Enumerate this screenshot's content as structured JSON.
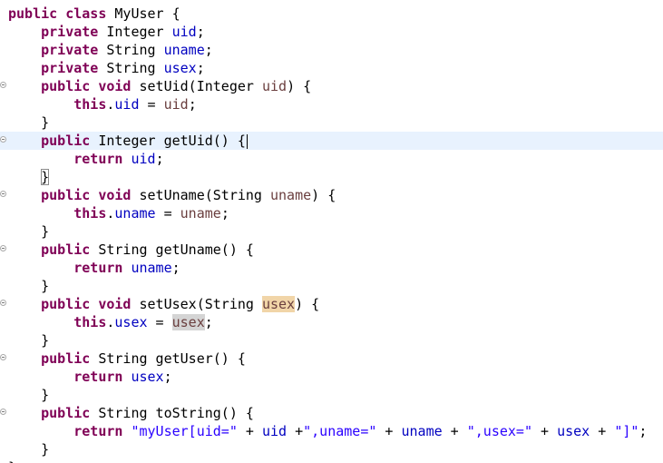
{
  "editor": {
    "language": "java",
    "colors": {
      "keyword": "#7f0055",
      "field": "#0000c0",
      "parameter": "#6a3e3e",
      "string": "#2a00ff",
      "current_line": "#e8f2fe",
      "occurrence_write": "#f1d5a8",
      "occurrence_read": "#d4d4d4"
    },
    "lines": [
      {
        "tokens": [
          {
            "t": "public class",
            "c": "kw"
          },
          {
            "t": " MyUser {",
            "c": ""
          }
        ]
      },
      {
        "tokens": [
          {
            "t": "    ",
            "c": ""
          },
          {
            "t": "private",
            "c": "kw"
          },
          {
            "t": " Integer ",
            "c": ""
          },
          {
            "t": "uid",
            "c": "fld"
          },
          {
            "t": ";",
            "c": ""
          }
        ]
      },
      {
        "tokens": [
          {
            "t": "    ",
            "c": ""
          },
          {
            "t": "private",
            "c": "kw"
          },
          {
            "t": " String ",
            "c": ""
          },
          {
            "t": "uname",
            "c": "fld"
          },
          {
            "t": ";",
            "c": ""
          }
        ]
      },
      {
        "tokens": [
          {
            "t": "    ",
            "c": ""
          },
          {
            "t": "private",
            "c": "kw"
          },
          {
            "t": " String ",
            "c": ""
          },
          {
            "t": "usex",
            "c": "fld"
          },
          {
            "t": ";",
            "c": ""
          }
        ]
      },
      {
        "fold": true,
        "tokens": [
          {
            "t": "    ",
            "c": ""
          },
          {
            "t": "public void",
            "c": "kw"
          },
          {
            "t": " setUid(Integer ",
            "c": ""
          },
          {
            "t": "uid",
            "c": "prm"
          },
          {
            "t": ") {",
            "c": ""
          }
        ]
      },
      {
        "tokens": [
          {
            "t": "        ",
            "c": ""
          },
          {
            "t": "this",
            "c": "kw"
          },
          {
            "t": ".",
            "c": ""
          },
          {
            "t": "uid",
            "c": "fld"
          },
          {
            "t": " = ",
            "c": ""
          },
          {
            "t": "uid",
            "c": "prm"
          },
          {
            "t": ";",
            "c": ""
          }
        ]
      },
      {
        "tokens": [
          {
            "t": "    }",
            "c": ""
          }
        ]
      },
      {
        "fold": true,
        "current": true,
        "caret": true,
        "tokens": [
          {
            "t": "    ",
            "c": ""
          },
          {
            "t": "public",
            "c": "kw"
          },
          {
            "t": " Integer getUid() {",
            "c": ""
          }
        ]
      },
      {
        "tokens": [
          {
            "t": "        ",
            "c": ""
          },
          {
            "t": "return",
            "c": "kw"
          },
          {
            "t": " ",
            "c": ""
          },
          {
            "t": "uid",
            "c": "fld"
          },
          {
            "t": ";",
            "c": ""
          }
        ]
      },
      {
        "tokens": [
          {
            "t": "    ",
            "c": ""
          },
          {
            "t": "}",
            "c": "bracket-box"
          }
        ]
      },
      {
        "fold": true,
        "tokens": [
          {
            "t": "    ",
            "c": ""
          },
          {
            "t": "public void",
            "c": "kw"
          },
          {
            "t": " setUname(String ",
            "c": ""
          },
          {
            "t": "uname",
            "c": "prm"
          },
          {
            "t": ") {",
            "c": ""
          }
        ]
      },
      {
        "tokens": [
          {
            "t": "        ",
            "c": ""
          },
          {
            "t": "this",
            "c": "kw"
          },
          {
            "t": ".",
            "c": ""
          },
          {
            "t": "uname",
            "c": "fld"
          },
          {
            "t": " = ",
            "c": ""
          },
          {
            "t": "uname",
            "c": "prm"
          },
          {
            "t": ";",
            "c": ""
          }
        ]
      },
      {
        "tokens": [
          {
            "t": "    }",
            "c": ""
          }
        ]
      },
      {
        "fold": true,
        "tokens": [
          {
            "t": "    ",
            "c": ""
          },
          {
            "t": "public",
            "c": "kw"
          },
          {
            "t": " String getUname() {",
            "c": ""
          }
        ]
      },
      {
        "tokens": [
          {
            "t": "        ",
            "c": ""
          },
          {
            "t": "return",
            "c": "kw"
          },
          {
            "t": " ",
            "c": ""
          },
          {
            "t": "uname",
            "c": "fld"
          },
          {
            "t": ";",
            "c": ""
          }
        ]
      },
      {
        "tokens": [
          {
            "t": "    }",
            "c": ""
          }
        ]
      },
      {
        "fold": true,
        "tokens": [
          {
            "t": "    ",
            "c": ""
          },
          {
            "t": "public void",
            "c": "kw"
          },
          {
            "t": " setUsex(String ",
            "c": ""
          },
          {
            "t": "usex",
            "c": "prm occ-write"
          },
          {
            "t": ") {",
            "c": ""
          }
        ]
      },
      {
        "tokens": [
          {
            "t": "        ",
            "c": ""
          },
          {
            "t": "this",
            "c": "kw"
          },
          {
            "t": ".",
            "c": ""
          },
          {
            "t": "usex",
            "c": "fld"
          },
          {
            "t": " = ",
            "c": ""
          },
          {
            "t": "usex",
            "c": "prm occ-read"
          },
          {
            "t": ";",
            "c": ""
          }
        ]
      },
      {
        "tokens": [
          {
            "t": "    }",
            "c": ""
          }
        ]
      },
      {
        "fold": true,
        "tokens": [
          {
            "t": "    ",
            "c": ""
          },
          {
            "t": "public",
            "c": "kw"
          },
          {
            "t": " String getUser() {",
            "c": ""
          }
        ]
      },
      {
        "tokens": [
          {
            "t": "        ",
            "c": ""
          },
          {
            "t": "return",
            "c": "kw"
          },
          {
            "t": " ",
            "c": ""
          },
          {
            "t": "usex",
            "c": "fld"
          },
          {
            "t": ";",
            "c": ""
          }
        ]
      },
      {
        "tokens": [
          {
            "t": "    }",
            "c": ""
          }
        ]
      },
      {
        "fold": true,
        "tokens": [
          {
            "t": "    ",
            "c": ""
          },
          {
            "t": "public",
            "c": "kw"
          },
          {
            "t": " String toString() {",
            "c": ""
          }
        ]
      },
      {
        "tokens": [
          {
            "t": "        ",
            "c": ""
          },
          {
            "t": "return",
            "c": "kw"
          },
          {
            "t": " ",
            "c": ""
          },
          {
            "t": "\"myUser[uid=\"",
            "c": "str"
          },
          {
            "t": " + ",
            "c": ""
          },
          {
            "t": "uid",
            "c": "fld"
          },
          {
            "t": " +",
            "c": ""
          },
          {
            "t": "\",uname=\"",
            "c": "str"
          },
          {
            "t": " + ",
            "c": ""
          },
          {
            "t": "uname",
            "c": "fld"
          },
          {
            "t": " + ",
            "c": ""
          },
          {
            "t": "\",usex=\"",
            "c": "str"
          },
          {
            "t": " + ",
            "c": ""
          },
          {
            "t": "usex",
            "c": "fld"
          },
          {
            "t": " + ",
            "c": ""
          },
          {
            "t": "\"]\"",
            "c": "str"
          },
          {
            "t": ";",
            "c": ""
          }
        ]
      },
      {
        "tokens": [
          {
            "t": "    }",
            "c": ""
          }
        ]
      },
      {
        "tokens": [
          {
            "t": "}",
            "c": ""
          }
        ]
      }
    ]
  }
}
